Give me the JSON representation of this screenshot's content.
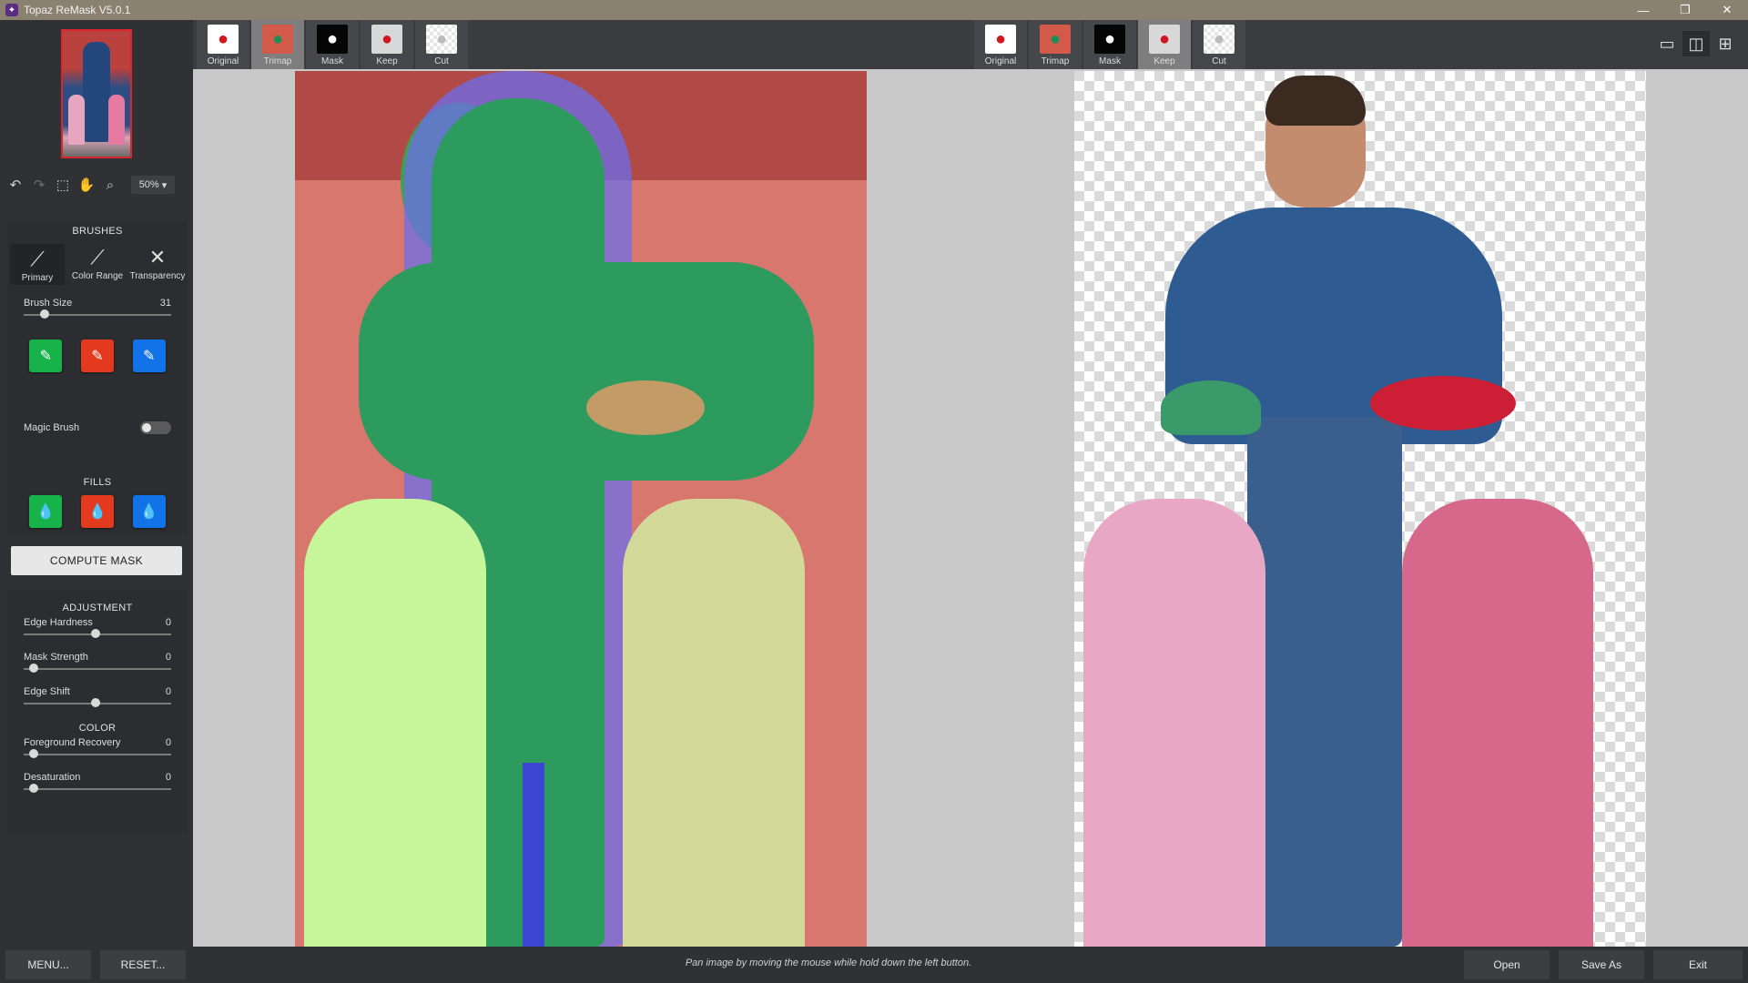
{
  "window": {
    "title": "Topaz ReMask V5.0.1"
  },
  "toolbar": {
    "zoom": "50%"
  },
  "brushes": {
    "title": "BRUSHES",
    "items": [
      {
        "label": "Primary"
      },
      {
        "label": "Color Range"
      },
      {
        "label": "Transparency"
      }
    ],
    "brush_size_label": "Brush Size",
    "brush_size_value": "31",
    "magic_brush_label": "Magic Brush"
  },
  "fills": {
    "title": "FILLS"
  },
  "compute_label": "COMPUTE MASK",
  "adjustment": {
    "title": "ADJUSTMENT",
    "edge_hardness_label": "Edge Hardness",
    "edge_hardness_value": "0",
    "mask_strength_label": "Mask Strength",
    "mask_strength_value": "0",
    "edge_shift_label": "Edge Shift",
    "edge_shift_value": "0"
  },
  "color": {
    "title": "COLOR",
    "fg_recovery_label": "Foreground Recovery",
    "fg_recovery_value": "0",
    "desaturation_label": "Desaturation",
    "desaturation_value": "0"
  },
  "left_tabs": [
    {
      "label": "Original"
    },
    {
      "label": "Trimap"
    },
    {
      "label": "Mask"
    },
    {
      "label": "Keep"
    },
    {
      "label": "Cut"
    }
  ],
  "right_tabs": [
    {
      "label": "Original"
    },
    {
      "label": "Trimap"
    },
    {
      "label": "Mask"
    },
    {
      "label": "Keep"
    },
    {
      "label": "Cut"
    }
  ],
  "bottom": {
    "menu_label": "MENU...",
    "reset_label": "RESET...",
    "status_text": "Pan image by moving the mouse while hold down the left button.",
    "open_label": "Open",
    "save_as_label": "Save As",
    "exit_label": "Exit"
  },
  "colors": {
    "keep_green": "#18b24b",
    "cut_red": "#e33a1f",
    "compute_blue": "#1273e8"
  }
}
